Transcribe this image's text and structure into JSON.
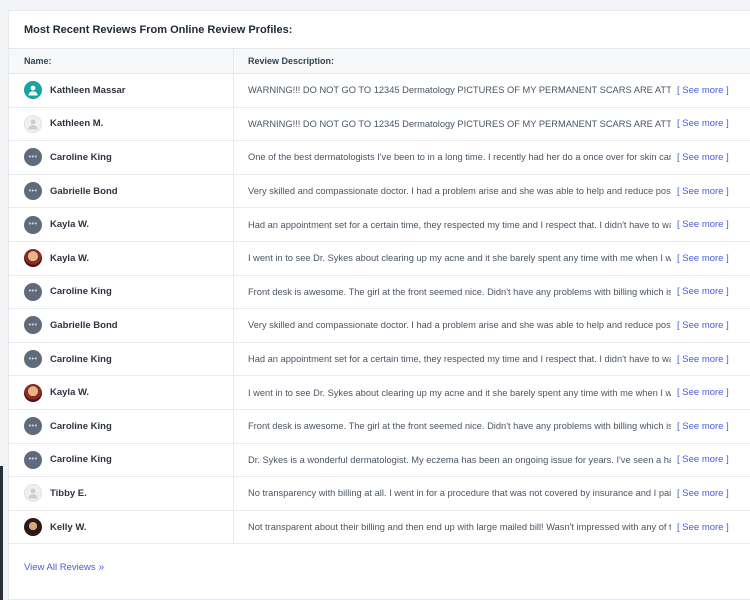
{
  "title": "Most Recent Reviews From Online Review Profiles:",
  "columns": {
    "name": "Name:",
    "description": "Review Description:"
  },
  "see_more_label": "[ See more ]",
  "view_all_label": "View All Reviews",
  "view_all_icon": "»",
  "rows": [
    {
      "name": "Kathleen Massar",
      "avatar": "teal-person-icon",
      "description": "WARNING!!! DO NOT GO TO  12345 Dermatology  PICTURES OF MY PERMANENT SCARS ARE ATTACHED"
    },
    {
      "name": "Kathleen M.",
      "avatar": "placeholder-person-icon",
      "description": "WARNING!!! DO NOT GO TO  12345 Dermatology  PICTURES OF MY PERMANENT SCARS ARE ATTACHED"
    },
    {
      "name": "Caroline King",
      "avatar": "dots-avatar-icon",
      "description": "One of the best dermatologists I've been to in a long time. I recently had her do a once over for skin cancer"
    },
    {
      "name": "Gabrielle Bond",
      "avatar": "dots-avatar-icon",
      "description": "Very skilled and compassionate doctor. I had a problem arise and she was able to help and reduce possible"
    },
    {
      "name": "Kayla W.",
      "avatar": "dots-avatar-icon",
      "description": "Had an appointment set for a certain time, they respected my time and I respect that. I didn't have to wait"
    },
    {
      "name": "Kayla W.",
      "avatar": "photo-avatar-icon",
      "description": "I went in to see  Dr. Sykes  about clearing up my acne and it she barely spent any time with me when I was"
    },
    {
      "name": "Caroline King",
      "avatar": "dots-avatar-icon",
      "description": "Front desk is awesome. The girl at the front seemed nice. Didn't have any problems with billing which is rare"
    },
    {
      "name": "Gabrielle Bond",
      "avatar": "dots-avatar-icon",
      "description": "Very skilled and compassionate doctor. I had a problem arise and she was able to help and reduce possible"
    },
    {
      "name": "Caroline King",
      "avatar": "dots-avatar-icon",
      "description": "Had an appointment set for a certain time, they respected my time and I respect that. I didn't have to wait"
    },
    {
      "name": "Kayla W.",
      "avatar": "photo-avatar-icon",
      "description": "I went in to see  Dr. Sykes  about clearing up my acne and it she barely spent any time with me when I was"
    },
    {
      "name": "Caroline King",
      "avatar": "dots-avatar-icon",
      "description": "Front desk is awesome. The girl at the front seemed nice. Didn't have any problems with billing which is rare"
    },
    {
      "name": "Caroline King",
      "avatar": "dots-avatar-icon",
      "description": " Dr. Sykes  is a wonderful dermatologist. My eczema has been an ongoing issue for years. I've seen a handful"
    },
    {
      "name": "Tibby E.",
      "avatar": "placeholder-person-icon",
      "description": "No transparency with billing at all. I went in for a procedure that was not covered by insurance and I paid"
    },
    {
      "name": "Kelly W.",
      "avatar": "dark-photo-avatar-icon",
      "description": "Not transparent about their billing and then end up with large mailed bill! Wasn't impressed with any of the"
    }
  ]
}
